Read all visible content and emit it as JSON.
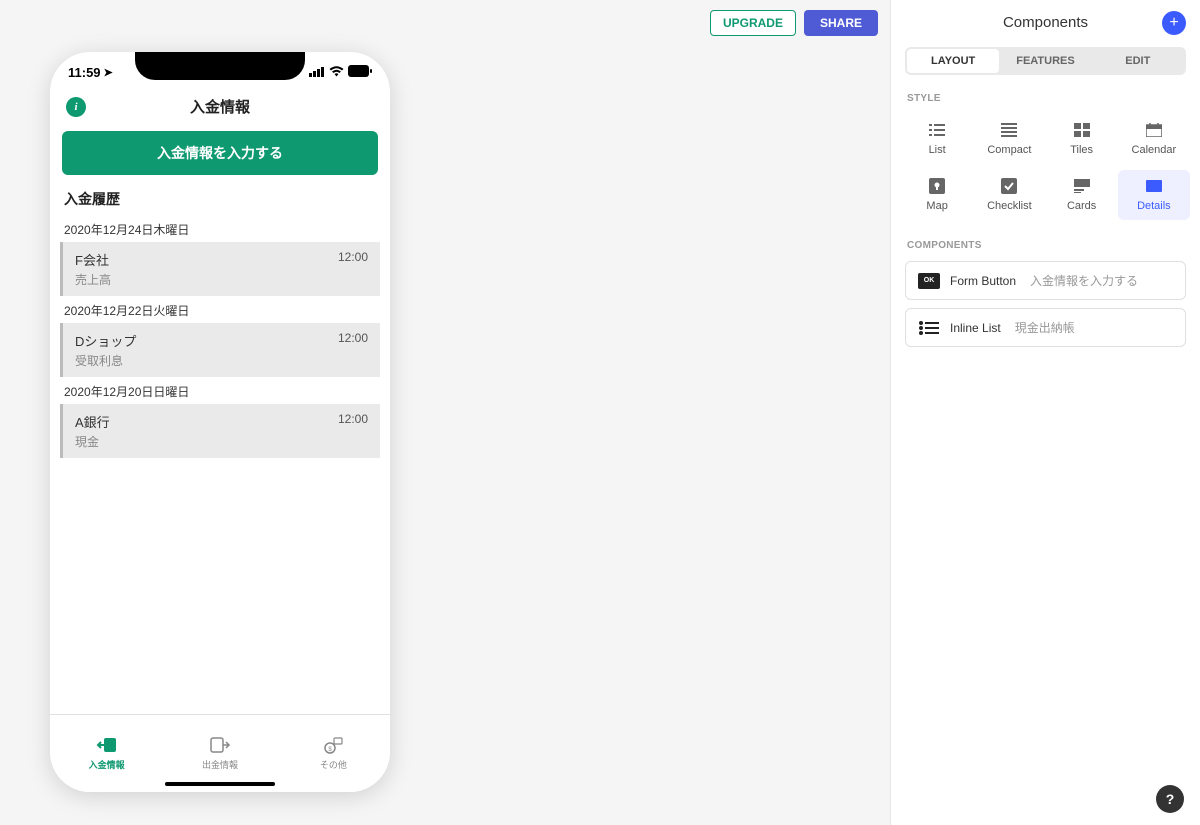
{
  "topbar": {
    "upgrade": "UPGRADE",
    "share": "SHARE"
  },
  "phone": {
    "time": "11:59",
    "header_title": "入金情報",
    "main_button": "入金情報を入力する",
    "section_heading": "入金履歴",
    "groups": [
      {
        "date": "2020年12月24日木曜日",
        "items": [
          {
            "title": "F会社",
            "sub": "売上高",
            "time": "12:00"
          }
        ]
      },
      {
        "date": "2020年12月22日火曜日",
        "items": [
          {
            "title": "Dショップ",
            "sub": "受取利息",
            "time": "12:00"
          }
        ]
      },
      {
        "date": "2020年12月20日日曜日",
        "items": [
          {
            "title": "A銀行",
            "sub": "現金",
            "time": "12:00"
          }
        ]
      }
    ],
    "tabs": [
      {
        "label": "入金情報",
        "active": true
      },
      {
        "label": "出金情報",
        "active": false
      },
      {
        "label": "その他",
        "active": false
      }
    ]
  },
  "panel": {
    "title": "Components",
    "mode_tabs": [
      "LAYOUT",
      "FEATURES",
      "EDIT"
    ],
    "active_mode": "LAYOUT",
    "style_label": "STYLE",
    "styles": [
      "List",
      "Compact",
      "Tiles",
      "Calendar",
      "Map",
      "Checklist",
      "Cards",
      "Details"
    ],
    "active_style": "Details",
    "components_label": "COMPONENTS",
    "components": [
      {
        "type": "Form Button",
        "name": "入金情報を入力する",
        "icon": "ok"
      },
      {
        "type": "Inline List",
        "name": "現金出納帳",
        "icon": "list"
      }
    ]
  }
}
